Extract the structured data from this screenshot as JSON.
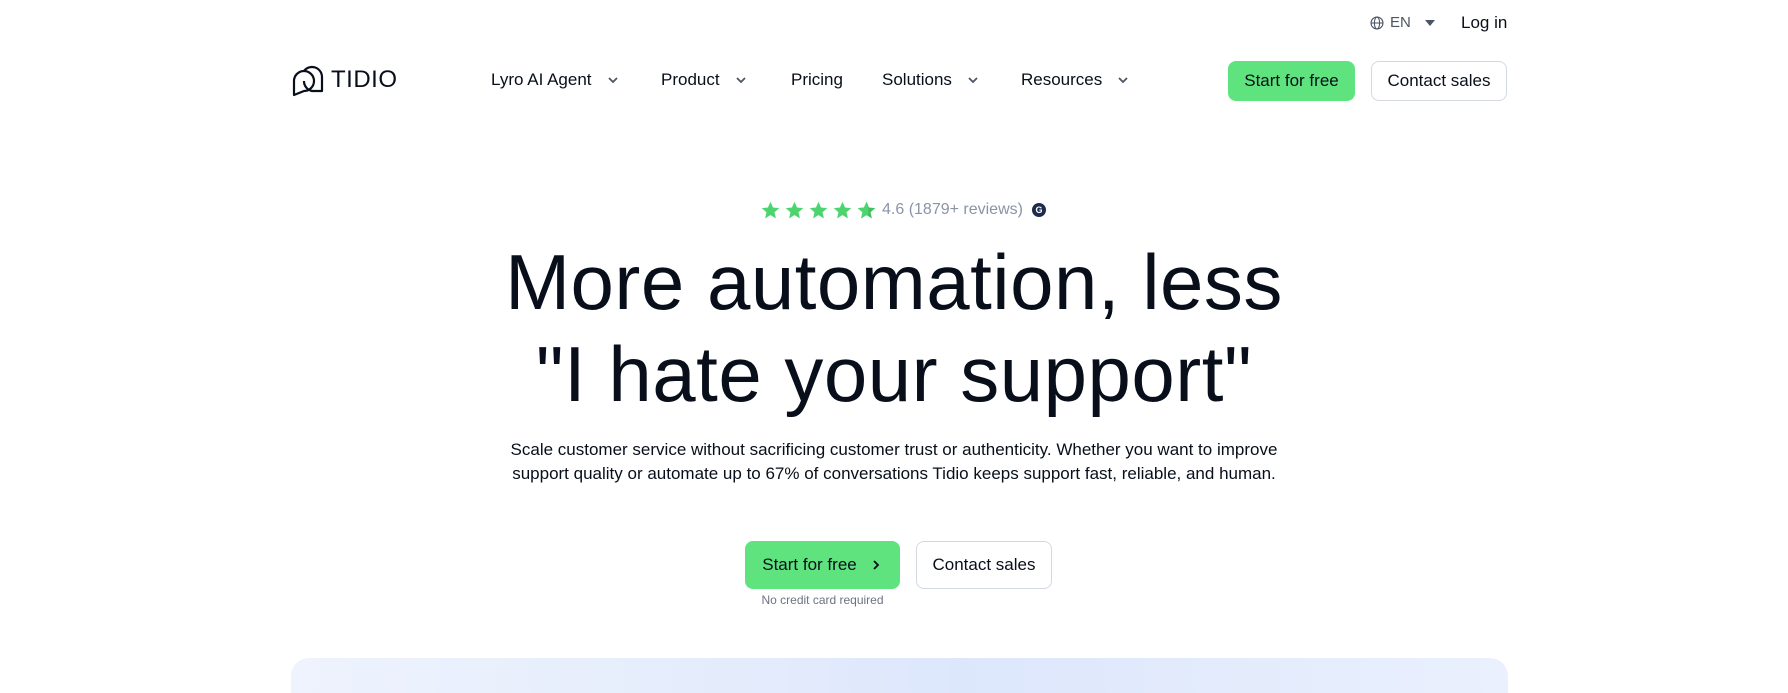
{
  "topbar": {
    "language": "EN",
    "login": "Log in"
  },
  "nav": {
    "logo_text": "TIDIO",
    "items": [
      {
        "label": "Lyro AI Agent",
        "has_dropdown": true
      },
      {
        "label": "Product",
        "has_dropdown": true
      },
      {
        "label": "Pricing",
        "has_dropdown": false
      },
      {
        "label": "Solutions",
        "has_dropdown": true
      },
      {
        "label": "Resources",
        "has_dropdown": true
      }
    ],
    "start_free": "Start for free",
    "contact_sales": "Contact sales"
  },
  "hero": {
    "rating_stars": 4.6,
    "rating_text": "4.6 (1879+ reviews)",
    "badge_letter": "G",
    "headline_line1": "More automation, less",
    "headline_line2": "\"I hate your support\"",
    "subtext_line1": "Scale customer service without sacrificing customer trust or authenticity. Whether you want to improve",
    "subtext_line2": "support quality or automate up to 67% of conversations Tidio keeps support fast, reliable, and human.",
    "start_free": "Start for free",
    "contact_sales": "Contact sales",
    "no_credit_card": "No credit card required"
  },
  "colors": {
    "accent_green": "#5fe37f",
    "star_green": "#4ed46f",
    "text_dark": "#080f1a",
    "muted": "#8a94a6"
  }
}
